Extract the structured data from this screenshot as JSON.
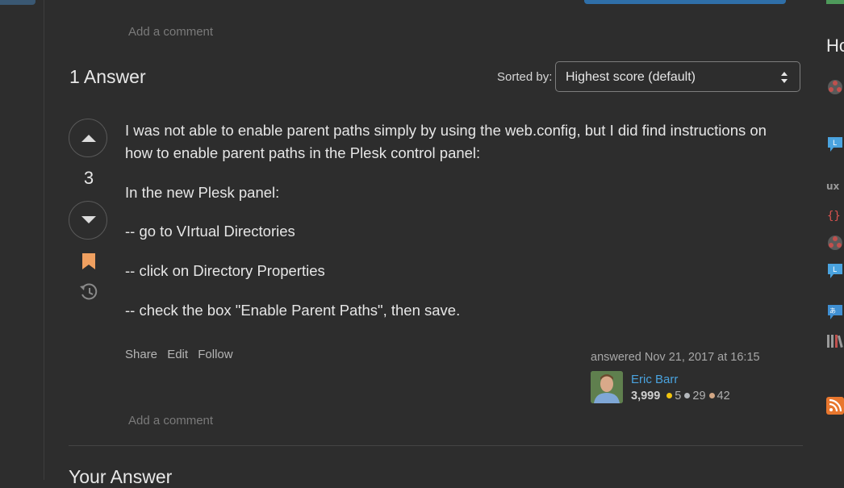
{
  "post_actions": {
    "add_comment_label": "Add a comment"
  },
  "answers": {
    "header": "1 Answer",
    "sorted_by_label": "Sorted by:",
    "sort_selected": "Highest score (default)"
  },
  "answer": {
    "score": "3",
    "body": [
      "I was not able to enable parent paths simply by using the web.config, but I did find instructions on",
      "how to enable parent paths in the Plesk control panel:",
      "In the new Plesk panel:",
      "-- go to VIrtual Directories",
      "-- click on Directory Properties",
      "-- check the box \"Enable Parent Paths\", then save."
    ],
    "menu": {
      "share": "Share",
      "edit": "Edit",
      "follow": "Follow"
    },
    "user": {
      "answered": "answered Nov 21, 2017 at 16:15",
      "name": "Eric Barr",
      "reputation": "3,999",
      "gold": "5",
      "silver": "29",
      "bronze": "42"
    },
    "add_comment_label": "Add a comment"
  },
  "your_answer_heading": "Your Answer",
  "sidebar": {
    "heading": "Ho",
    "icons": [
      "network-icon",
      "chat-bubble-icon",
      "ux-icon",
      "braces-icon",
      "network-icon",
      "chat-bubble-icon",
      "language-icon",
      "books-icon",
      "rss-icon"
    ]
  },
  "colors": {
    "accent_blue": "#4aa3df",
    "bookmark": "#f0a060",
    "background": "#2d2d2d"
  }
}
